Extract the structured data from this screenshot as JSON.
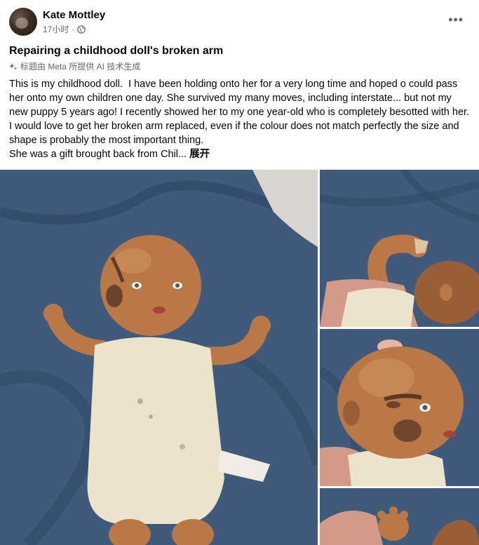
{
  "post": {
    "author": "Kate Mottley",
    "time": "17小时",
    "separator": "·",
    "title": "Repairing a childhood doll's broken arm",
    "ai_label": "标题由 Meta 所提供 AI 技术生成",
    "body": "This is my childhood doll.  I have been holding onto her for a very long time and hoped o could pass her onto my own children one day. She survived my many moves, including interstate... but not my new puppy 5 years ago! I recently showed her to my one year-old who is completely besotted with her. I would love to get her broken arm replaced, even if the colour does not match perfectly the size and shape is probably the most important thing.\nShe was a gift brought back from Chil...",
    "see_more": "展开"
  },
  "icons": {
    "more": "more-horizontal-icon",
    "audience": "globe-icon",
    "ai": "sparkle-icon"
  },
  "colors": {
    "text_primary": "#050505",
    "text_secondary": "#65676b",
    "backdrop_blue": "#3f5a7a",
    "doll_skin": "#b97845",
    "doll_body": "#ece3cc"
  }
}
